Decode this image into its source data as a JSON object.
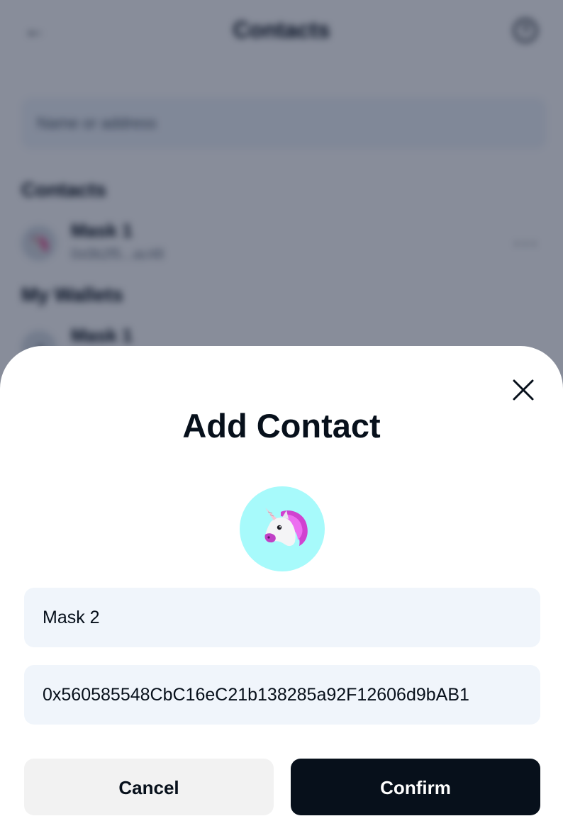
{
  "background": {
    "header": {
      "title": "Contacts",
      "back_icon": "arrow-left-icon",
      "help_icon": "question-circle-icon"
    },
    "search": {
      "placeholder": "Name or address"
    },
    "sections": {
      "contacts_title": "Contacts",
      "wallets_title": "My Wallets"
    },
    "contact_row": {
      "name": "Mask 1",
      "address": "0x0b2f5...ac48",
      "avatar_icon": "unicorn-icon",
      "more_icon": "ellipsis-icon"
    },
    "wallet_row": {
      "name": "Mask 1",
      "avatar_icon": "wallet-icon"
    }
  },
  "modal": {
    "title": "Add Contact",
    "close_icon": "close-icon",
    "avatar_icon": "unicorn-icon",
    "avatar_bg": "#a7fafb",
    "name_value": "Mask 2",
    "address_value": "0x560585548CbC16eC21b138285a92F12606d9bAB1",
    "cancel_label": "Cancel",
    "confirm_label": "Confirm"
  },
  "colors": {
    "primary_text": "#07101b",
    "confirm_bg": "#07101b",
    "cancel_bg": "#f2f2f2",
    "field_bg": "#f0f5fb",
    "overlay": "rgba(7, 16, 44, 0.48)"
  }
}
